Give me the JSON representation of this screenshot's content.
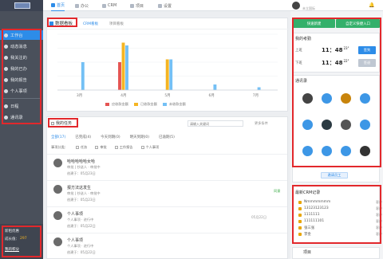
{
  "nav": {
    "items": [
      {
        "label": "首页",
        "icon": "home-icon"
      },
      {
        "label": "办公",
        "icon": "briefcase-icon"
      },
      {
        "label": "CRM",
        "icon": "crm-icon"
      },
      {
        "label": "项目",
        "icon": "project-icon"
      },
      {
        "label": "设置",
        "icon": "gear-icon"
      }
    ],
    "user_name": "",
    "user_company": "未立国际",
    "bell": "🔔"
  },
  "sidebar": {
    "items": [
      {
        "label": "工作台",
        "icon": "dashboard-icon"
      },
      {
        "label": "动态消息",
        "icon": "message-icon"
      },
      {
        "label": "我关注的",
        "icon": "star-icon"
      },
      {
        "label": "我的已办",
        "icon": "check-icon"
      },
      {
        "label": "我的报告",
        "icon": "report-icon"
      },
      {
        "label": "个人事项",
        "icon": "person-icon"
      },
      {
        "label": "日程",
        "icon": "calendar-icon"
      },
      {
        "label": "通讯录",
        "icon": "contacts-icon"
      }
    ],
    "footer": {
      "line1": "新租优惠",
      "line2": "成长值：",
      "line2_value": "297",
      "link": "我的积分"
    }
  },
  "chart_panel": {
    "header": "数据看板",
    "tabs": [
      "CRM看板",
      "项目看板"
    ],
    "months": [
      "3月",
      "4月",
      "5月",
      "6月",
      "7月"
    ]
  },
  "chart_data": {
    "type": "bar",
    "categories": [
      "3月",
      "4月",
      "5月",
      "6月",
      "7月"
    ],
    "series": [
      {
        "name": "应收款金额",
        "values": [
          0,
          10,
          0,
          0,
          0
        ],
        "color": "#e55452"
      },
      {
        "name": "已收款金额",
        "values": [
          0,
          17,
          11,
          0,
          0
        ],
        "color": "#f5b523"
      },
      {
        "name": "未收款金额",
        "values": [
          10,
          16,
          11,
          2,
          1
        ],
        "color": "#74c0f5"
      }
    ],
    "ylim": [
      0,
      20
    ],
    "grid": true,
    "legend": "bottom"
  },
  "feed": {
    "header": "我的任务",
    "search_placeholder": "请输入关键词",
    "filter_label": "更多条件",
    "tabs": [
      {
        "label": "全部",
        "count": "17"
      },
      {
        "label": "已完成",
        "count": "4"
      },
      {
        "label": "今天到期",
        "count": "0"
      },
      {
        "label": "明天到期",
        "count": "0"
      },
      {
        "label": "已逾期",
        "count": "5"
      }
    ],
    "checks_label": "事项分类：",
    "checks": [
      "任务",
      "审批",
      "工作报告",
      "个人事项"
    ],
    "items": [
      {
        "title": "哈哈哈哈哈女哈",
        "meta": "审批  |  抄送人",
        "meta2": "审批中",
        "date": "创建于：05月23日",
        "flag": ""
      },
      {
        "title": "报方法这发生",
        "meta": "审批  |  抄送人",
        "meta2": "审批中",
        "date": "创建于：05月23日",
        "flag": "同意"
      },
      {
        "title": "个人事项",
        "meta": "个人事项",
        "meta2": "进行中",
        "date": "创建于：05月22日",
        "flag": "05月22日"
      },
      {
        "title": "个人事项",
        "meta": "个人事项",
        "meta2": "进行中",
        "date": "创建于：05月22日",
        "flag": ""
      }
    ]
  },
  "right": {
    "quick": {
      "btn1": "快速新建",
      "btn2": "自定义快捷入口"
    },
    "clock": {
      "header": "我的考勤",
      "am_label": "上班",
      "am_time": "11：48",
      "am_sec": "23\"",
      "am_btn": "签到",
      "pm_label": "下班",
      "pm_time": "11：48",
      "pm_sec": "22\"",
      "pm_btn": "签退"
    },
    "contacts": {
      "header": "通讯录",
      "add_btn": "邀请员工"
    },
    "crm": {
      "header": "最新CRM记录",
      "rows": [
        {
          "text": "Nmmmmmmm",
          "tag": "客户"
        },
        {
          "text": "13123123123",
          "tag": "客户"
        },
        {
          "text": "1111111",
          "tag": "客户"
        },
        {
          "text": "111111101",
          "tag": "客户"
        },
        {
          "text": "张三张",
          "tag": "客户"
        },
        {
          "text": "李金",
          "tag": "客户"
        }
      ]
    },
    "project_header": "项目"
  }
}
